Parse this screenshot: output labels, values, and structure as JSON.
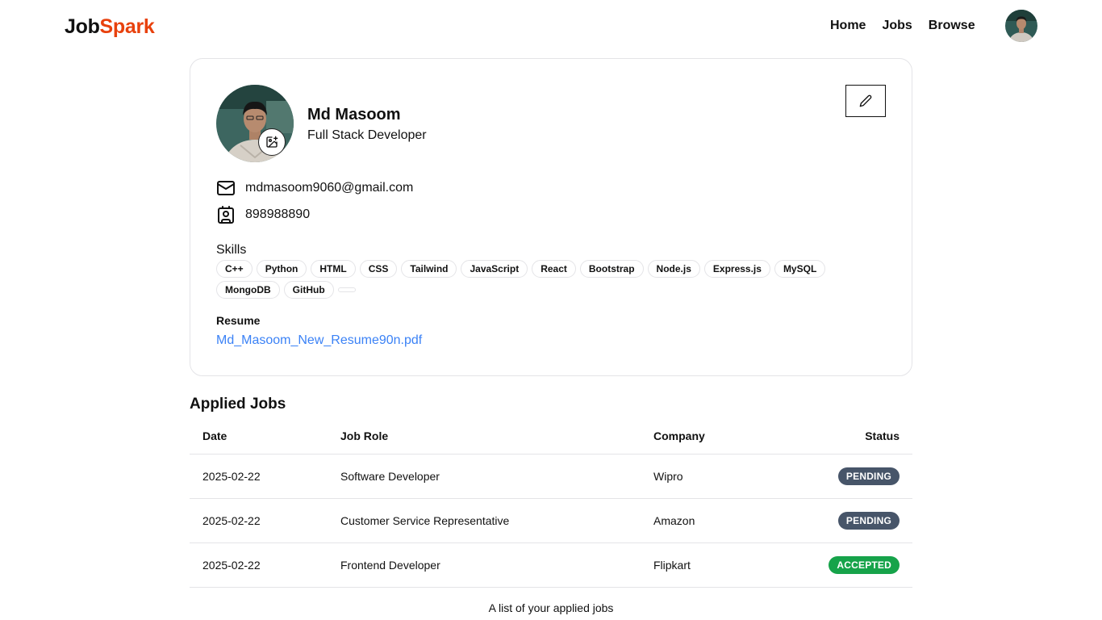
{
  "navbar": {
    "logo_part1": "Job",
    "logo_part2": "Spark",
    "links": [
      "Home",
      "Jobs",
      "Browse"
    ],
    "avatar_icon": "user-avatar"
  },
  "profile": {
    "name": "Md Masoom",
    "title": "Full Stack Developer",
    "email": "mdmasoom9060@gmail.com",
    "phone": "898988890",
    "skills_label": "Skills",
    "skills": [
      "C++",
      "Python",
      "HTML",
      "CSS",
      "Tailwind",
      "JavaScript",
      "React",
      "Bootstrap",
      "Node.js",
      "Express.js",
      "MySQL",
      "MongoDB",
      "GitHub"
    ],
    "resume_label": "Resume",
    "resume_file": "Md_Masoom_New_Resume90n.pdf"
  },
  "applied_jobs": {
    "title": "Applied Jobs",
    "headers": {
      "date": "Date",
      "role": "Job Role",
      "company": "Company",
      "status": "Status"
    },
    "rows": [
      {
        "date": "2025-02-22",
        "role": "Software Developer",
        "company": "Wipro",
        "status": "PENDING"
      },
      {
        "date": "2025-02-22",
        "role": "Customer Service Representative",
        "company": "Amazon",
        "status": "PENDING"
      },
      {
        "date": "2025-02-22",
        "role": "Frontend Developer",
        "company": "Flipkart",
        "status": "ACCEPTED"
      }
    ],
    "caption": "A list of your applied jobs"
  },
  "colors": {
    "brand_accent": "#e8410d",
    "link": "#3b82f6",
    "pending": "#475569",
    "accepted": "#16a34a"
  }
}
